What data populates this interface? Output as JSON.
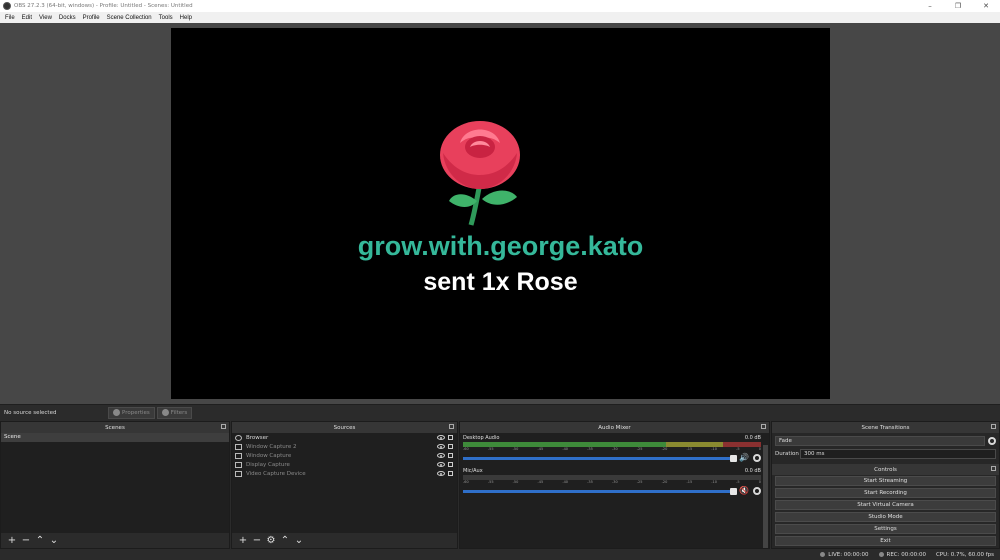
{
  "window": {
    "title": "OBS 27.2.3 (64-bit, windows) - Profile: Untitled - Scenes: Untitled",
    "minimize": "–",
    "maximize": "❐",
    "close": "✕"
  },
  "menu": [
    "File",
    "Edit",
    "View",
    "Docks",
    "Profile",
    "Scene Collection",
    "Tools",
    "Help"
  ],
  "preview": {
    "alert_user": "grow.with.george.kato",
    "alert_message": "sent 1x Rose",
    "alert_user_color": "#35b89a"
  },
  "context_bar": {
    "status": "No source selected",
    "properties_label": "Properties",
    "filters_label": "Filters"
  },
  "scenes": {
    "title": "Scenes",
    "items": [
      "Scene"
    ]
  },
  "sources": {
    "title": "Sources",
    "items": [
      {
        "label": "Browser",
        "icon": "globe-icon",
        "active": true
      },
      {
        "label": "Window Capture 2",
        "icon": "window-icon",
        "active": false
      },
      {
        "label": "Window Capture",
        "icon": "window-icon",
        "active": false
      },
      {
        "label": "Display Capture",
        "icon": "monitor-icon",
        "active": false
      },
      {
        "label": "Video Capture Device",
        "icon": "camera-icon",
        "active": false
      }
    ]
  },
  "mixer": {
    "title": "Audio Mixer",
    "ticks": [
      "-60",
      "-55",
      "-50",
      "-45",
      "-40",
      "-35",
      "-30",
      "-25",
      "-20",
      "-15",
      "-10",
      "-5",
      "0"
    ],
    "tracks": [
      {
        "name": "Desktop Audio",
        "db": "0.0 dB",
        "muted": false,
        "volume": 1.0
      },
      {
        "name": "Mic/Aux",
        "db": "0.0 dB",
        "muted": true,
        "volume": 1.0
      }
    ]
  },
  "transitions": {
    "title": "Scene Transitions",
    "selected": "Fade",
    "duration_label": "Duration",
    "duration_value": "300 ms"
  },
  "controls": {
    "title": "Controls",
    "buttons": [
      "Start Streaming",
      "Start Recording",
      "Start Virtual Camera",
      "Studio Mode",
      "Settings",
      "Exit"
    ]
  },
  "status": {
    "live": "LIVE: 00:00:00",
    "rec": "REC: 00:00:00",
    "cpu": "CPU: 0.7%, 60.00 fps"
  },
  "colors": {
    "accent_slider": "#2f6fc9",
    "muted_red": "#d03434"
  }
}
